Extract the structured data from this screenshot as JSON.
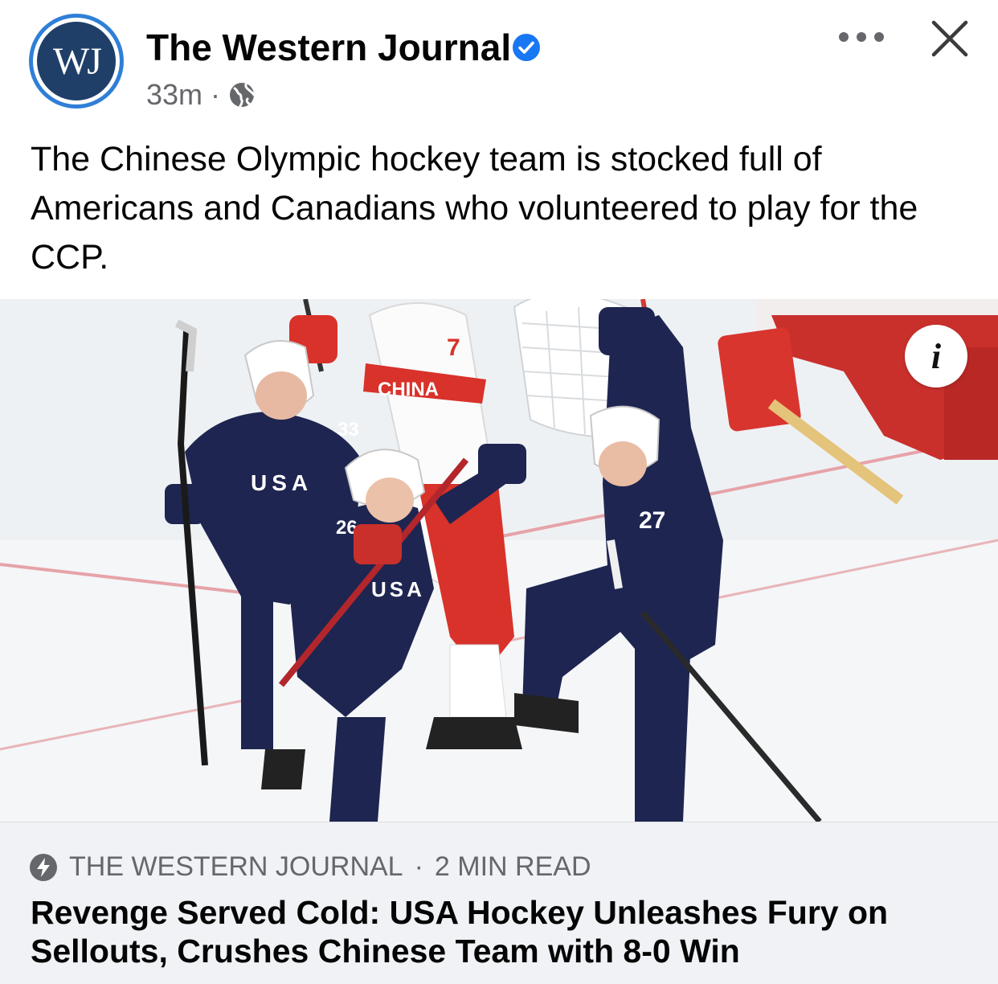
{
  "post": {
    "page_name": "The Western Journal",
    "avatar_initials": "WJ",
    "timestamp": "33m",
    "separator": "·",
    "text": "The Chinese Olympic hockey team is stocked full of Americans and Canadians who volunteered to play for the CCP."
  },
  "media": {
    "alt": "USA hockey players celebrating a goal against China",
    "info_glyph": "i",
    "jersey_text": {
      "usa": "USA",
      "china": "CHINA",
      "numbers": [
        "27",
        "26",
        "33",
        "7"
      ]
    }
  },
  "link_card": {
    "source": "THE WESTERN JOURNAL",
    "read_time": "2 MIN READ",
    "separator": "·",
    "headline": "Revenge Served Cold: USA Hockey Unleashes Fury on Sellouts, Crushes Chinese Team with 8-0 Win"
  },
  "icons": {
    "verified": "verified-badge-icon",
    "globe": "globe-icon",
    "more": "more-options-icon",
    "close": "close-icon",
    "info": "info-icon",
    "bolt": "lightning-bolt-icon"
  },
  "colors": {
    "facebook_blue": "#1877f2",
    "avatar_navy": "#1f3f69",
    "avatar_ring": "#2f7fd7",
    "usa_navy": "#1e2550",
    "china_red": "#d8322a",
    "meta_gray": "#65676b",
    "card_bg": "#f0f2f5"
  }
}
